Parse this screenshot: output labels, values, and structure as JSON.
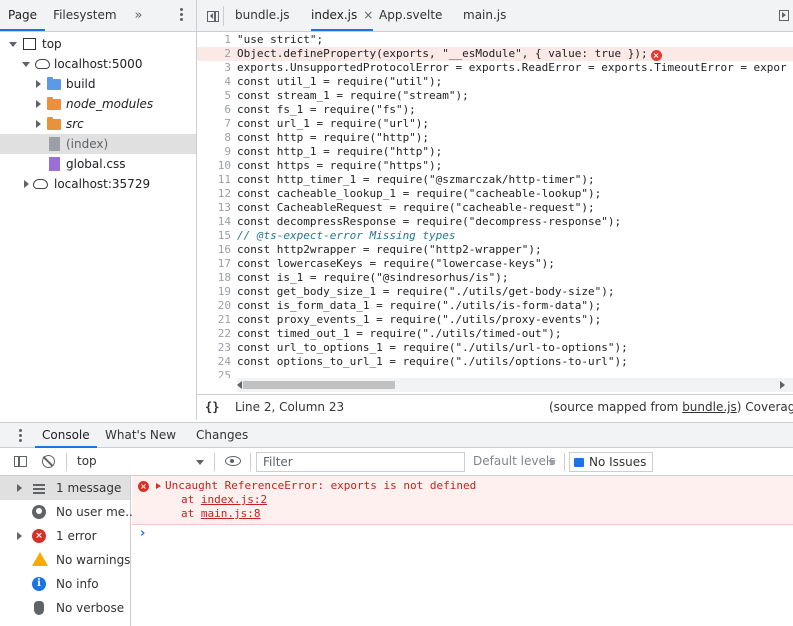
{
  "navigator": {
    "tabs": [
      "Page",
      "Filesystem"
    ],
    "more": "»",
    "tree": [
      {
        "label": "top"
      },
      {
        "label": "localhost:5000"
      },
      {
        "label": "build"
      },
      {
        "label": "node_modules"
      },
      {
        "label": "src"
      },
      {
        "label": "(index)"
      },
      {
        "label": "global.css"
      },
      {
        "label": "localhost:35729"
      }
    ]
  },
  "editor": {
    "tabs": [
      {
        "label": "bundle.js"
      },
      {
        "label": "index.js",
        "close": "×"
      },
      {
        "label": "App.svelte"
      },
      {
        "label": "main.js"
      }
    ],
    "code_lines": [
      "\"use strict\";",
      "Object.defineProperty(exports, \"__esModule\", { value: true });",
      "exports.UnsupportedProtocolError = exports.ReadError = exports.TimeoutError = expor",
      "const util_1 = require(\"util\");",
      "const stream_1 = require(\"stream\");",
      "const fs_1 = require(\"fs\");",
      "const url_1 = require(\"url\");",
      "const http = require(\"http\");",
      "const http_1 = require(\"http\");",
      "const https = require(\"https\");",
      "const http_timer_1 = require(\"@szmarczak/http-timer\");",
      "const cacheable_lookup_1 = require(\"cacheable-lookup\");",
      "const CacheableRequest = require(\"cacheable-request\");",
      "const decompressResponse = require(\"decompress-response\");",
      "// @ts-expect-error Missing types",
      "const http2wrapper = require(\"http2-wrapper\");",
      "const lowercaseKeys = require(\"lowercase-keys\");",
      "const is_1 = require(\"@sindresorhus/is\");",
      "const get_body_size_1 = require(\"./utils/get-body-size\");",
      "const is_form_data_1 = require(\"./utils/is-form-data\");",
      "const proxy_events_1 = require(\"./utils/proxy-events\");",
      "const timed_out_1 = require(\"./utils/timed-out\");",
      "const url_to_options_1 = require(\"./utils/url-to-options\");",
      "const options_to_url_1 = require(\"./utils/options-to-url\");",
      ""
    ],
    "line_numbers": [
      "1",
      "2",
      "3",
      "4",
      "5",
      "6",
      "7",
      "8",
      "9",
      "10",
      "11",
      "12",
      "13",
      "14",
      "15",
      "16",
      "17",
      "18",
      "19",
      "20",
      "21",
      "22",
      "23",
      "24",
      "25"
    ],
    "error_marker": "×",
    "status": {
      "braces": "{}",
      "cursor": "Line 2, Column 23",
      "source_prefix": "(source mapped from ",
      "source_link": "bundle.js",
      "source_suffix": ")",
      "coverage": "Coverage: n/a"
    }
  },
  "drawer": {
    "tabs": [
      "Console",
      "What's New",
      "Changes"
    ]
  },
  "console_toolbar": {
    "context": "top",
    "filter_placeholder": "Filter",
    "levels": "Default levels",
    "issues": "No Issues"
  },
  "console_sidebar": {
    "items": [
      {
        "label": "1 message",
        "icon": "list-icon"
      },
      {
        "label": "No user me...",
        "icon": "user-icon"
      },
      {
        "label": "1 error",
        "icon": "error-icon"
      },
      {
        "label": "No warnings",
        "icon": "warning-icon"
      },
      {
        "label": "No info",
        "icon": "info-icon"
      },
      {
        "label": "No verbose",
        "icon": "bug-icon"
      }
    ],
    "error_glyph": "×",
    "info_glyph": "i"
  },
  "console_output": {
    "error_text": "Uncaught ReferenceError: exports is not defined",
    "stack": [
      {
        "prefix": "at ",
        "link": "index.js:2"
      },
      {
        "prefix": "at ",
        "link": "main.js:8"
      }
    ],
    "error_glyph": "×",
    "prompt": "›"
  }
}
